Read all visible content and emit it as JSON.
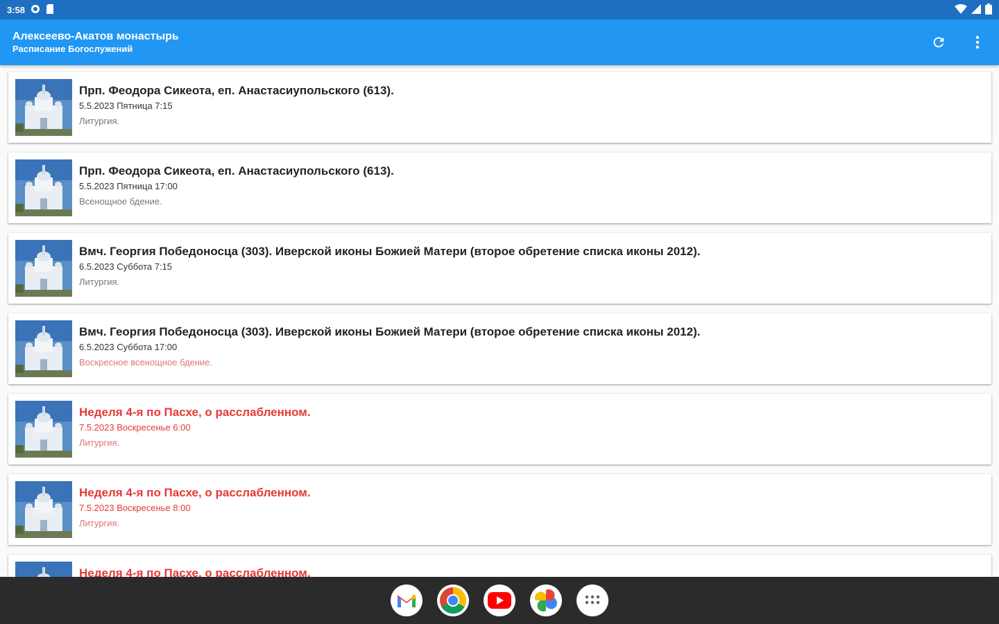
{
  "status_bar": {
    "time": "3:58"
  },
  "app_bar": {
    "title": "Алексеево-Акатов монастырь",
    "subtitle": "Расписание Богослужений",
    "refresh_icon": "refresh-icon",
    "menu_icon": "more-vert-icon"
  },
  "colors": {
    "appbar": "#2196f3",
    "statusbar": "#1e6fc1",
    "feast_red": "#e53935"
  },
  "events": [
    {
      "title": "Прп. Феодора Сикеота, еп. Анастасиупольского (613).",
      "date": "5.5.2023  Пятница 7:15",
      "service": "Литургия."
    },
    {
      "title": "Прп. Феодора Сикеота, еп. Анастасиупольского (613).",
      "date": "5.5.2023  Пятница 17:00",
      "service": "Всенощное бдение."
    },
    {
      "title": "Вмч. Георгия Победоносца (303). Иверской иконы Божией Матери (второе обретение списка иконы 2012).",
      "date": "6.5.2023  Суббота 7:15",
      "service": "Литургия."
    },
    {
      "title": "Вмч. Георгия Победоносца (303). Иверской иконы Божией Матери (второе обретение списка иконы 2012).",
      "date": "6.5.2023  Суббота 17:00",
      "service": "Воскресное всенощное бдение."
    },
    {
      "title": "Неделя 4-я по Пасхе, о расслабленном.",
      "date": "7.5.2023  Воскресенье 6:00",
      "service": "Литургия."
    },
    {
      "title": "Неделя 4-я по Пасхе, о расслабленном.",
      "date": "7.5.2023  Воскресенье 8:00",
      "service": "Литургия."
    },
    {
      "title": "Неделя 4-я по Пасхе, о расслабленном.",
      "date": "",
      "service": ""
    }
  ],
  "dock": [
    "gmail-icon",
    "chrome-icon",
    "youtube-icon",
    "photos-icon",
    "app-drawer-icon"
  ]
}
